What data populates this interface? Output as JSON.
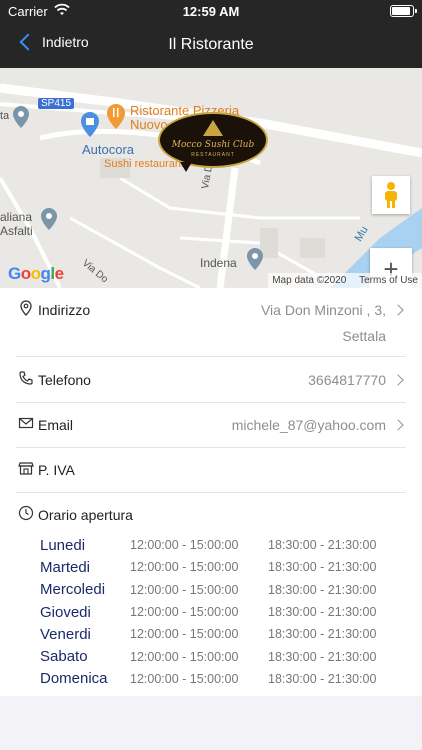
{
  "status_bar": {
    "carrier": "Carrier",
    "time": "12:59 AM",
    "battery_level": 1.0
  },
  "nav": {
    "back_label": "Indietro",
    "title": "Il Ristorante",
    "accent": "#3a8ef6"
  },
  "map": {
    "labels": {
      "road": "SP415",
      "poi_main": "Ristorante Pizzeria Nuovo",
      "poi_sushi": "Sushi restaurant",
      "autocora": "Autocora",
      "street": "Via Don Minzoni",
      "indena": "Indena",
      "italiana": "aliana",
      "asfalti": "Asfalti",
      "sta": "ta",
      "via_do": "Via Do",
      "mu": "Mu"
    },
    "logo_text": "Mocco Sushi Club",
    "logo_sub": "RESTAURANT",
    "map_data": "Map data ©2020",
    "terms": "Terms of Use",
    "zoom_in": "+",
    "zoom_out": "−",
    "google": [
      "G",
      "o",
      "o",
      "g",
      "l",
      "e"
    ]
  },
  "info": {
    "address": {
      "label": "Indirizzo",
      "line1": "Via Don Minzoni , 3,",
      "line2": "Settala"
    },
    "phone": {
      "label": "Telefono",
      "value": "3664817770"
    },
    "email": {
      "label": "Email",
      "value": "michele_87@yahoo.com"
    },
    "vat": {
      "label": "P. IVA",
      "value": ""
    },
    "hours_title": "Orario apertura"
  },
  "hours": [
    {
      "day": "Lunedi",
      "morning": "12:00:00 - 15:00:00",
      "evening": "18:30:00 - 21:30:00"
    },
    {
      "day": "Martedi",
      "morning": "12:00:00 - 15:00:00",
      "evening": "18:30:00 - 21:30:00"
    },
    {
      "day": "Mercoledi",
      "morning": "12:00:00 - 15:00:00",
      "evening": "18:30:00 - 21:30:00"
    },
    {
      "day": "Giovedi",
      "morning": "12:00:00 - 15:00:00",
      "evening": "18:30:00 - 21:30:00"
    },
    {
      "day": "Venerdi",
      "morning": "12:00:00 - 15:00:00",
      "evening": "18:30:00 - 21:30:00"
    },
    {
      "day": "Sabato",
      "morning": "12:00:00 - 15:00:00",
      "evening": "18:30:00 - 21:30:00"
    },
    {
      "day": "Domenica",
      "morning": "12:00:00 - 15:00:00",
      "evening": "18:30:00 - 21:30:00"
    }
  ]
}
